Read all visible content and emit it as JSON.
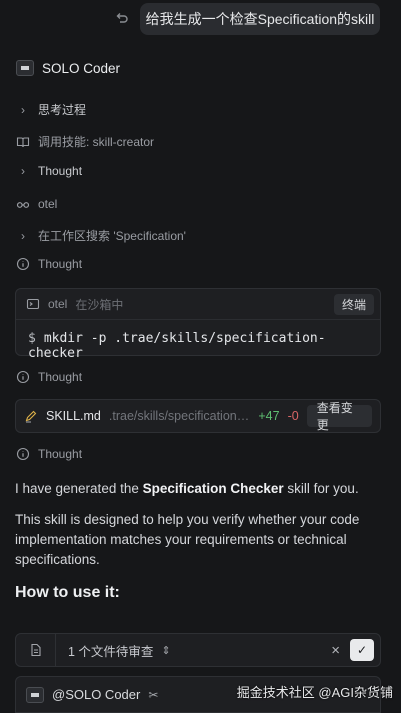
{
  "user_message": "给我生成一个检查Specification的skill",
  "agent": {
    "name": "SOLO Coder"
  },
  "steps": {
    "thinking": "思考过程",
    "skill_call_label": "调用技能: skill-creator",
    "thought_1": "Thought",
    "otel": "otel",
    "search": "在工作区搜索 'Specification'",
    "thought_2": "Thought",
    "thought_3": "Thought",
    "thought_4": "Thought"
  },
  "terminal": {
    "name": "otel",
    "status": "在沙箱中",
    "button": "终端",
    "prompt": "$",
    "command": "mkdir -p .trae/skills/specification-checker"
  },
  "file_change": {
    "file": "SKILL.md",
    "path": ".trae/skills/specification-...",
    "added": "+47",
    "removed": "-0",
    "button": "查看变更"
  },
  "response": {
    "p1_pre": "I have generated the ",
    "p1_bold": "Specification Checker",
    "p1_post": " skill for you.",
    "p2": "This skill is designed to help you verify whether your code implementation matches your requirements or technical specifications.",
    "heading": "How to use it:"
  },
  "review": {
    "label": "1 个文件待审查",
    "close": "×",
    "accept": "✓"
  },
  "input": {
    "mention": "@SOLO Coder"
  },
  "watermark": "掘金技术社区 @AGI杂货铺"
}
